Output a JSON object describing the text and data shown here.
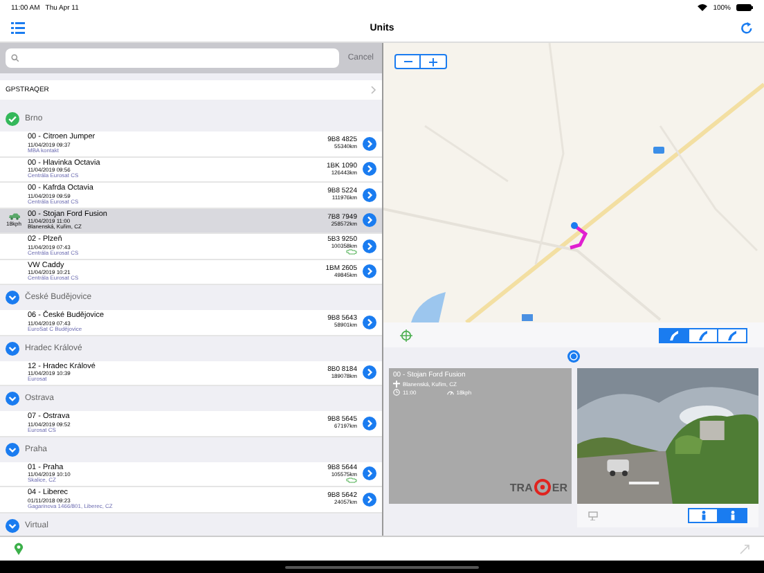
{
  "status_bar": {
    "time": "11:00 AM",
    "date": "Thu Apr 11",
    "battery": "100%"
  },
  "nav": {
    "title": "Units"
  },
  "search": {
    "cancel": "Cancel"
  },
  "account": {
    "label": "GPSTRAQER"
  },
  "sections": [
    {
      "name": "Brno",
      "checked": true,
      "units": [
        {
          "name": "00 - Citroen Jumper",
          "time": "11/04/2019 09:37",
          "place": "MBA kontakt",
          "plate": "9B8 4825",
          "distance": "55340km",
          "selected": false,
          "ignition": false
        },
        {
          "name": "00 - Hlavinka Octavia",
          "time": "11/04/2019 09:56",
          "place": "Centrála Eurosat CS",
          "plate": "1BK 1090",
          "distance": "126443km",
          "selected": false,
          "ignition": false
        },
        {
          "name": "00 - Kafrda Octavia",
          "time": "11/04/2019 09:59",
          "place": "Centrála Eurosat CS",
          "plate": "9B8 5224",
          "distance": "111976km",
          "selected": false,
          "ignition": false
        },
        {
          "name": "00 - Stojan Ford Fusion",
          "time": "11/04/2019 11:00",
          "place": "Blanenská, Kuřim, CZ",
          "plate": "7B8 7949",
          "distance": "258572km",
          "selected": true,
          "ignition": false,
          "speed": "18kph"
        },
        {
          "name": "02 - Plzeň",
          "time": "11/04/2019 07:43",
          "place": "Centrála Eurosat CS",
          "plate": "5B3 9250",
          "distance": "100358km",
          "selected": false,
          "ignition": true
        },
        {
          "name": "VW Caddy",
          "time": "11/04/2019 10:21",
          "place": "Centrála Eurosat CS",
          "plate": "1BM 2605",
          "distance": "49845km",
          "selected": false,
          "ignition": false
        }
      ]
    },
    {
      "name": "České Budějovice",
      "checked": false,
      "units": [
        {
          "name": "06 - České Budějovice",
          "time": "11/04/2019 07:43",
          "place": "EuroSat C Budějovice",
          "plate": "9B8 5643",
          "distance": "58901km",
          "selected": false,
          "ignition": false
        }
      ]
    },
    {
      "name": "Hradec Králové",
      "checked": false,
      "units": [
        {
          "name": "12 - Hradec Králové",
          "time": "11/04/2019 10:39",
          "place": "Eurosat",
          "plate": "8B0 8184",
          "distance": "189078km",
          "selected": false,
          "ignition": false
        }
      ]
    },
    {
      "name": "Ostrava",
      "checked": false,
      "units": [
        {
          "name": "07 - Ostrava",
          "time": "11/04/2019 09:52",
          "place": "Eurosat CS",
          "plate": "9B8 5645",
          "distance": "67197km",
          "selected": false,
          "ignition": false
        }
      ]
    },
    {
      "name": "Praha",
      "checked": false,
      "units": [
        {
          "name": "01 - Praha",
          "time": "11/04/2019 10:10",
          "place": "Skalice, CZ",
          "plate": "9B8 5644",
          "distance": "105575km",
          "selected": false,
          "ignition": true
        },
        {
          "name": "04 - Liberec",
          "time": "01/11/2018 09:23",
          "place": "Gagarinova 1466/801, Liberec, CZ",
          "plate": "9B8 5642",
          "distance": "24057km",
          "selected": false,
          "ignition": false
        }
      ]
    },
    {
      "name": "Virtual",
      "checked": false
    }
  ],
  "map_modes": [
    {
      "selected": true
    },
    {
      "selected": false
    },
    {
      "selected": false
    }
  ],
  "info_card": {
    "name": "00 - Stojan Ford Fusion",
    "address": "Blanenská, Kuřim, CZ",
    "time": "11:00",
    "speed": "18kph",
    "logo_left": "TRA",
    "logo_right": "ER"
  },
  "photo_modes": [
    {
      "selected": false
    },
    {
      "selected": true
    }
  ]
}
